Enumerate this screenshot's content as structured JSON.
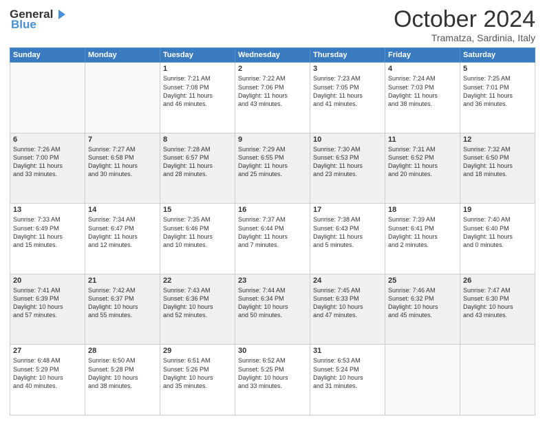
{
  "logo": {
    "part1": "General",
    "part2": "Blue"
  },
  "title": "October 2024",
  "location": "Tramatza, Sardinia, Italy",
  "headers": [
    "Sunday",
    "Monday",
    "Tuesday",
    "Wednesday",
    "Thursday",
    "Friday",
    "Saturday"
  ],
  "weeks": [
    [
      {
        "day": "",
        "info": ""
      },
      {
        "day": "",
        "info": ""
      },
      {
        "day": "1",
        "info": "Sunrise: 7:21 AM\nSunset: 7:08 PM\nDaylight: 11 hours\nand 46 minutes."
      },
      {
        "day": "2",
        "info": "Sunrise: 7:22 AM\nSunset: 7:06 PM\nDaylight: 11 hours\nand 43 minutes."
      },
      {
        "day": "3",
        "info": "Sunrise: 7:23 AM\nSunset: 7:05 PM\nDaylight: 11 hours\nand 41 minutes."
      },
      {
        "day": "4",
        "info": "Sunrise: 7:24 AM\nSunset: 7:03 PM\nDaylight: 11 hours\nand 38 minutes."
      },
      {
        "day": "5",
        "info": "Sunrise: 7:25 AM\nSunset: 7:01 PM\nDaylight: 11 hours\nand 36 minutes."
      }
    ],
    [
      {
        "day": "6",
        "info": "Sunrise: 7:26 AM\nSunset: 7:00 PM\nDaylight: 11 hours\nand 33 minutes."
      },
      {
        "day": "7",
        "info": "Sunrise: 7:27 AM\nSunset: 6:58 PM\nDaylight: 11 hours\nand 30 minutes."
      },
      {
        "day": "8",
        "info": "Sunrise: 7:28 AM\nSunset: 6:57 PM\nDaylight: 11 hours\nand 28 minutes."
      },
      {
        "day": "9",
        "info": "Sunrise: 7:29 AM\nSunset: 6:55 PM\nDaylight: 11 hours\nand 25 minutes."
      },
      {
        "day": "10",
        "info": "Sunrise: 7:30 AM\nSunset: 6:53 PM\nDaylight: 11 hours\nand 23 minutes."
      },
      {
        "day": "11",
        "info": "Sunrise: 7:31 AM\nSunset: 6:52 PM\nDaylight: 11 hours\nand 20 minutes."
      },
      {
        "day": "12",
        "info": "Sunrise: 7:32 AM\nSunset: 6:50 PM\nDaylight: 11 hours\nand 18 minutes."
      }
    ],
    [
      {
        "day": "13",
        "info": "Sunrise: 7:33 AM\nSunset: 6:49 PM\nDaylight: 11 hours\nand 15 minutes."
      },
      {
        "day": "14",
        "info": "Sunrise: 7:34 AM\nSunset: 6:47 PM\nDaylight: 11 hours\nand 12 minutes."
      },
      {
        "day": "15",
        "info": "Sunrise: 7:35 AM\nSunset: 6:46 PM\nDaylight: 11 hours\nand 10 minutes."
      },
      {
        "day": "16",
        "info": "Sunrise: 7:37 AM\nSunset: 6:44 PM\nDaylight: 11 hours\nand 7 minutes."
      },
      {
        "day": "17",
        "info": "Sunrise: 7:38 AM\nSunset: 6:43 PM\nDaylight: 11 hours\nand 5 minutes."
      },
      {
        "day": "18",
        "info": "Sunrise: 7:39 AM\nSunset: 6:41 PM\nDaylight: 11 hours\nand 2 minutes."
      },
      {
        "day": "19",
        "info": "Sunrise: 7:40 AM\nSunset: 6:40 PM\nDaylight: 11 hours\nand 0 minutes."
      }
    ],
    [
      {
        "day": "20",
        "info": "Sunrise: 7:41 AM\nSunset: 6:39 PM\nDaylight: 10 hours\nand 57 minutes."
      },
      {
        "day": "21",
        "info": "Sunrise: 7:42 AM\nSunset: 6:37 PM\nDaylight: 10 hours\nand 55 minutes."
      },
      {
        "day": "22",
        "info": "Sunrise: 7:43 AM\nSunset: 6:36 PM\nDaylight: 10 hours\nand 52 minutes."
      },
      {
        "day": "23",
        "info": "Sunrise: 7:44 AM\nSunset: 6:34 PM\nDaylight: 10 hours\nand 50 minutes."
      },
      {
        "day": "24",
        "info": "Sunrise: 7:45 AM\nSunset: 6:33 PM\nDaylight: 10 hours\nand 47 minutes."
      },
      {
        "day": "25",
        "info": "Sunrise: 7:46 AM\nSunset: 6:32 PM\nDaylight: 10 hours\nand 45 minutes."
      },
      {
        "day": "26",
        "info": "Sunrise: 7:47 AM\nSunset: 6:30 PM\nDaylight: 10 hours\nand 43 minutes."
      }
    ],
    [
      {
        "day": "27",
        "info": "Sunrise: 6:48 AM\nSunset: 5:29 PM\nDaylight: 10 hours\nand 40 minutes."
      },
      {
        "day": "28",
        "info": "Sunrise: 6:50 AM\nSunset: 5:28 PM\nDaylight: 10 hours\nand 38 minutes."
      },
      {
        "day": "29",
        "info": "Sunrise: 6:51 AM\nSunset: 5:26 PM\nDaylight: 10 hours\nand 35 minutes."
      },
      {
        "day": "30",
        "info": "Sunrise: 6:52 AM\nSunset: 5:25 PM\nDaylight: 10 hours\nand 33 minutes."
      },
      {
        "day": "31",
        "info": "Sunrise: 6:53 AM\nSunset: 5:24 PM\nDaylight: 10 hours\nand 31 minutes."
      },
      {
        "day": "",
        "info": ""
      },
      {
        "day": "",
        "info": ""
      }
    ]
  ]
}
